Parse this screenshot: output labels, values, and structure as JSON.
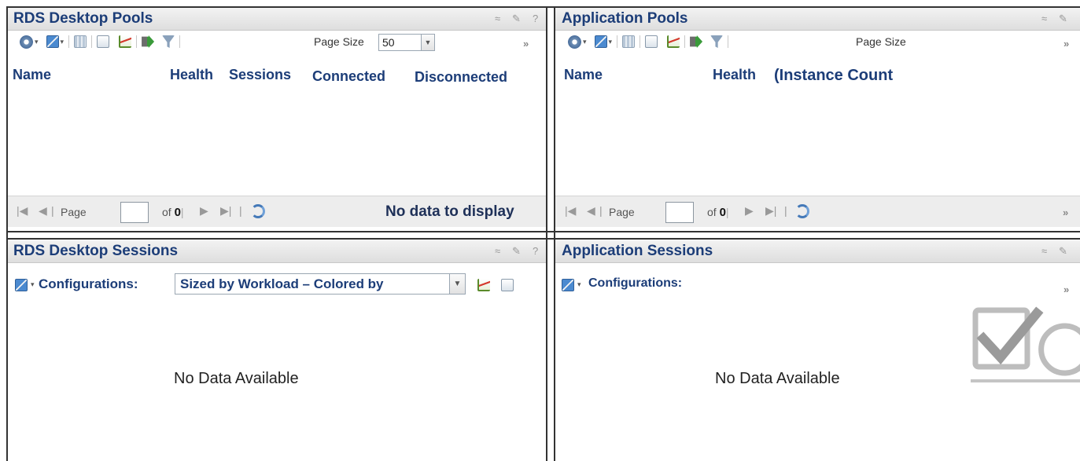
{
  "panels": {
    "rds_pools": {
      "title": "RDS Desktop Pools",
      "page_size_label": "Page Size",
      "page_size_value": "50",
      "columns": [
        "Name",
        "Health",
        "Sessions",
        "Connected",
        "Disconnected"
      ],
      "pager": {
        "page_label": "Page",
        "of_label": "of",
        "total": "0",
        "status": "No data to display"
      }
    },
    "app_pools": {
      "title": "Application Pools",
      "page_size_label": "Page Size",
      "columns": [
        "Name",
        "Health",
        "(Instance Count"
      ],
      "pager": {
        "page_label": "Page",
        "of_label": "of",
        "total": "0"
      }
    },
    "rds_sessions": {
      "title": "RDS Desktop Sessions",
      "config_label": "Configurations:",
      "config_value": "Sized by Workload – Colored by",
      "empty": "No Data Available"
    },
    "app_sessions": {
      "title": "Application Sessions",
      "config_label": "Configurations:",
      "empty": "No Data Available"
    }
  },
  "controls": {
    "collapse": "≈",
    "edit": "✎",
    "help": "?",
    "more": "»"
  },
  "colors": {
    "title": "#1c3d78",
    "border": "#333333",
    "header_bg": "#e6e6e6"
  }
}
